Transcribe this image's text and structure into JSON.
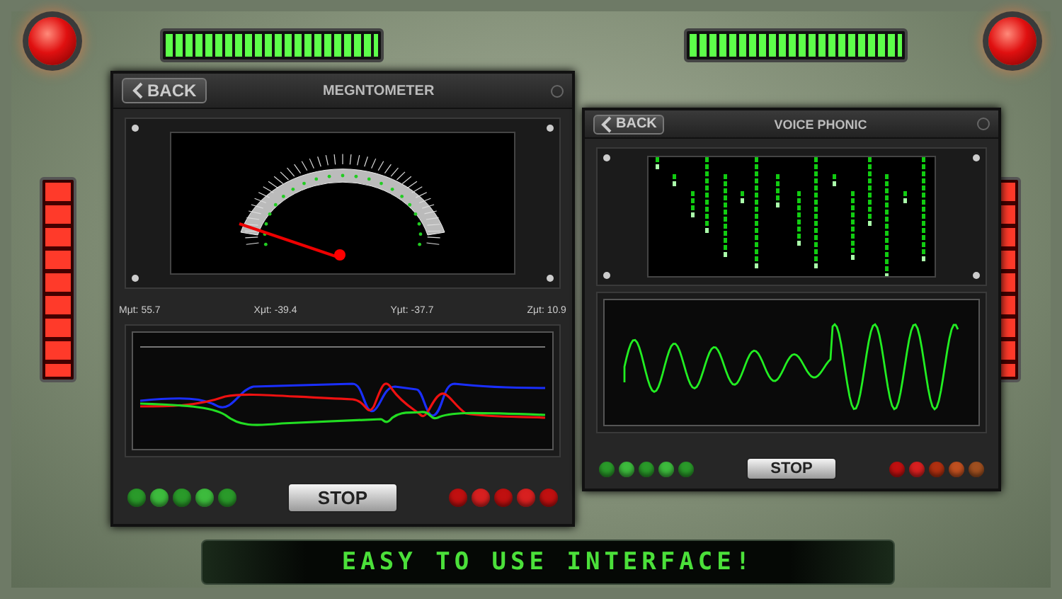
{
  "meters": [
    {
      "kind": "knob"
    },
    {
      "kind": "bar",
      "level": 1
    },
    {
      "kind": "bar",
      "level": 1
    },
    {
      "kind": "knob"
    }
  ],
  "side_meters": [
    {
      "level": 1
    },
    {
      "level": 1
    }
  ],
  "panels": [
    {
      "back": "BACK",
      "title": "MEGNTOMETER",
      "display": {
        "kind": "gauge"
      },
      "readings": [
        "Mμt: 55.7",
        "Xμt: -39.4",
        "Yμt: -37.7",
        "Zμt: 10.9"
      ],
      "graph": {
        "kind": "lines"
      },
      "stop": "STOP",
      "leds_left": [
        {
          "color": "#2a9a2a"
        },
        {
          "color": "#3dbb3d"
        },
        {
          "color": "#2a9a2a"
        },
        {
          "color": "#3dbb3d"
        },
        {
          "color": "#2a9a2a"
        }
      ],
      "leds_right": [
        {
          "color": "#c01010"
        },
        {
          "color": "#d82020"
        },
        {
          "color": "#c01010"
        },
        {
          "color": "#d82020"
        },
        {
          "color": "#c01010"
        }
      ]
    },
    {
      "back": "BACK",
      "title": "VOICE PHONIC",
      "display": {
        "kind": "rain"
      },
      "graph": {
        "kind": "wave"
      },
      "stop": "STOP",
      "leds_left": [
        {
          "color": "#2a9a2a"
        },
        {
          "color": "#3dbb3d"
        },
        {
          "color": "#2a9a2a"
        },
        {
          "color": "#3dbb3d"
        },
        {
          "color": "#2a9a2a"
        }
      ],
      "leds_right": [
        {
          "color": "#c01010"
        },
        {
          "color": "#d82020"
        },
        {
          "color": "#b03010"
        },
        {
          "color": "#c05020"
        },
        {
          "color": "#a05020"
        }
      ]
    }
  ],
  "banner": "EASY TO USE INTERFACE!"
}
